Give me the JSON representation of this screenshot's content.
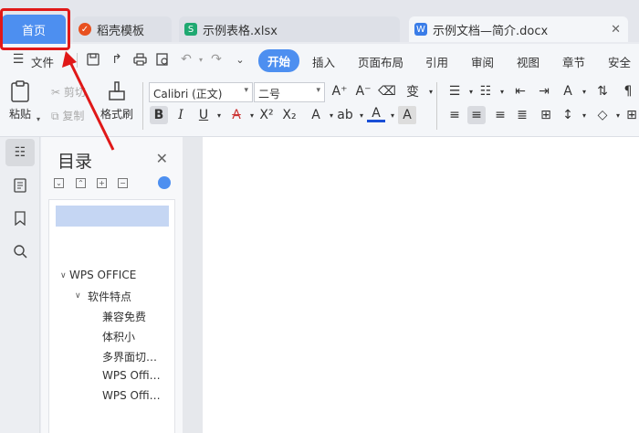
{
  "tabs": {
    "home": "首页",
    "template": "稻壳模板",
    "spreadsheet": "示例表格.xlsx",
    "document": "示例文档—简介.docx"
  },
  "menu": {
    "file": "文件",
    "start": "开始",
    "insert": "插入",
    "layout": "页面布局",
    "reference": "引用",
    "review": "审阅",
    "view": "视图",
    "chapter": "章节",
    "security": "安全"
  },
  "ribbon": {
    "paste": "粘贴",
    "cut": "剪切",
    "copy": "复制",
    "format_painter": "格式刷",
    "font_name": "Calibri (正文)",
    "font_size": "二号"
  },
  "toc": {
    "title": "目录",
    "items": [
      {
        "label": "WPS OFFICE",
        "level": 1
      },
      {
        "label": "软件特点",
        "level": 2
      },
      {
        "label": "兼容免费",
        "level": 3
      },
      {
        "label": "体积小",
        "level": 3
      },
      {
        "label": "多界面切…",
        "level": 3
      },
      {
        "label": "WPS Offi…",
        "level": 3
      },
      {
        "label": "WPS Offi…",
        "level": 3
      }
    ]
  },
  "colors": {
    "accent": "#4d8ff0",
    "annotation_red": "#e01818"
  }
}
